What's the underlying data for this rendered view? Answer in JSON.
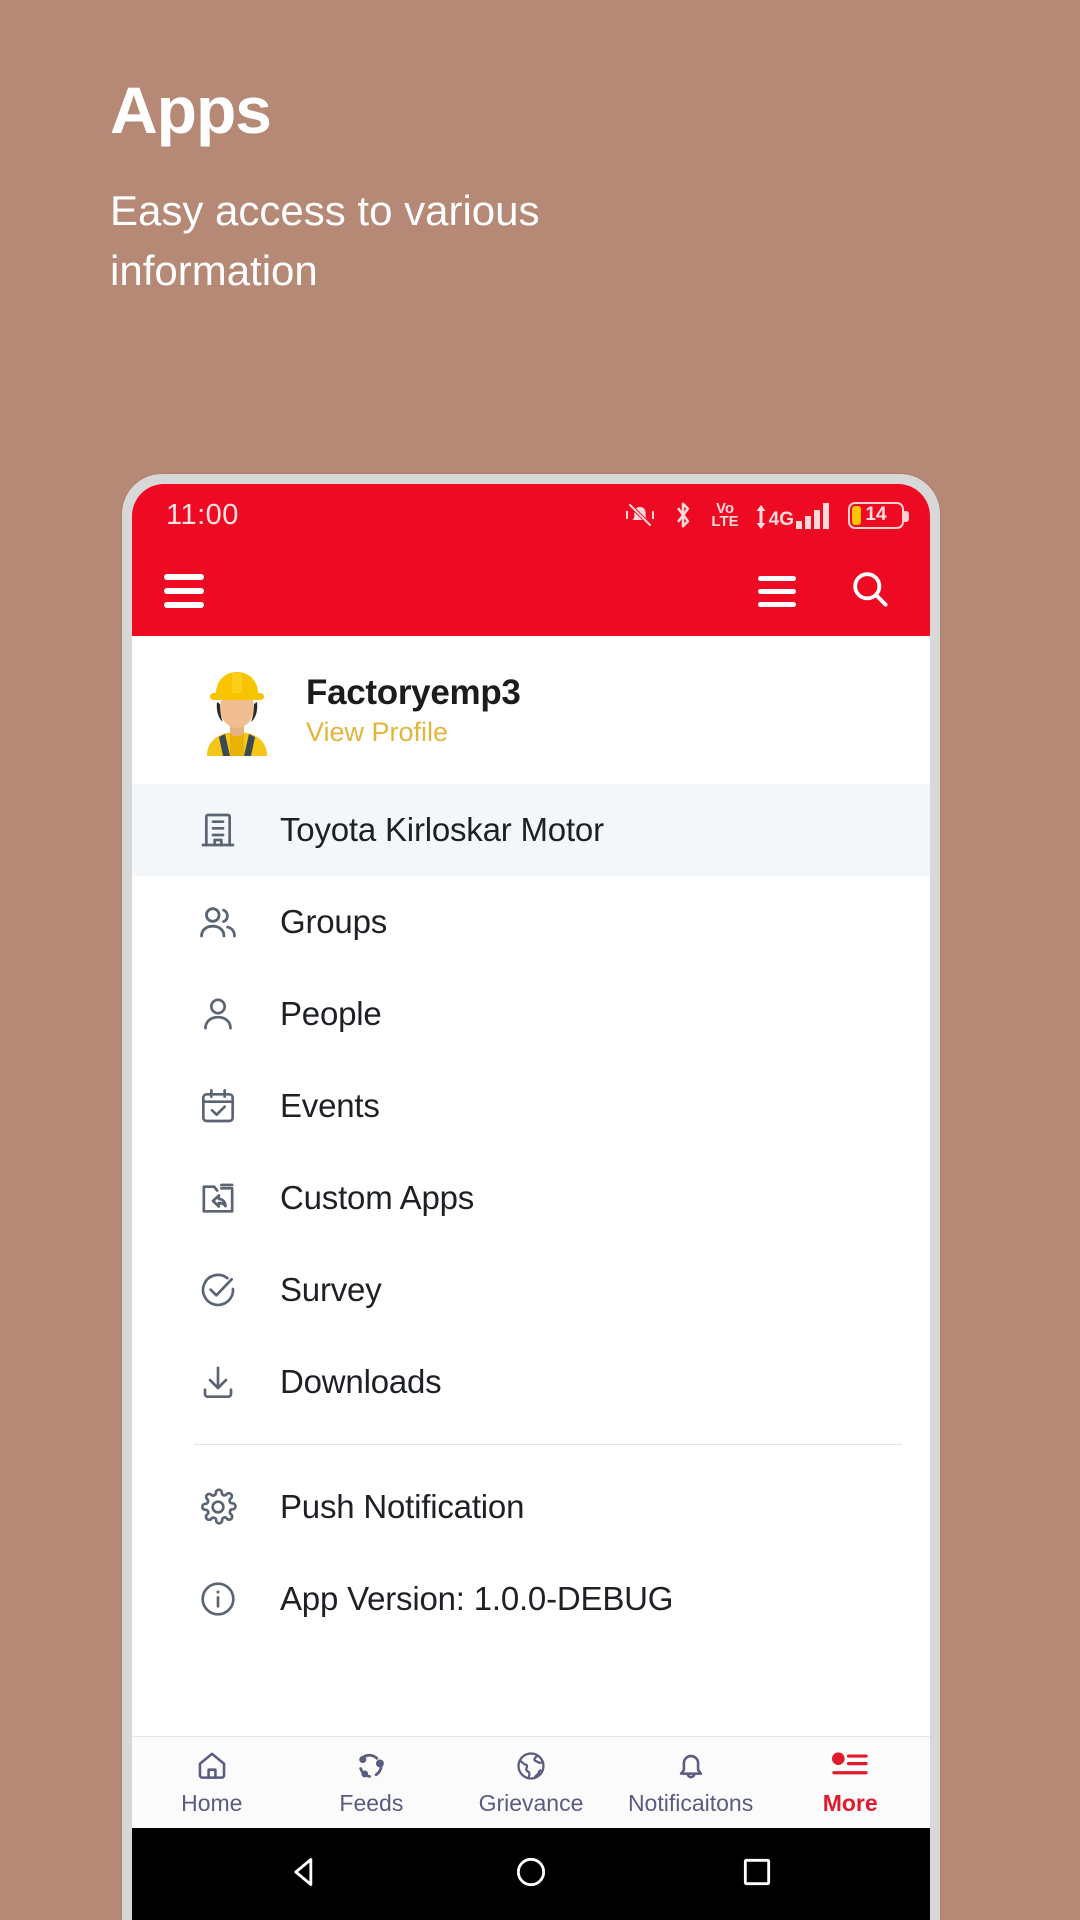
{
  "promo": {
    "title": "Apps",
    "subtitle": "Easy access to various information"
  },
  "colors": {
    "background": "#b68876",
    "brand_red": "#ee0a22",
    "accent_gold": "#e2b63c",
    "nav_inactive": "#5a5b80",
    "nav_active": "#e11b2e",
    "bezel": "#d8d8d8"
  },
  "status_bar": {
    "time": "11:00",
    "battery_percent": "14",
    "network": "4G",
    "volte_top": "Vo",
    "volte_bottom": "LTE",
    "icons": [
      "mute-vibrate-icon",
      "bluetooth-icon",
      "volte-icon",
      "signal-4g-icon",
      "battery-icon"
    ]
  },
  "app_bar": {
    "menu_icon": "hamburger-menu-icon",
    "right_menu_icon": "hamburger-menu-icon",
    "search_icon": "search-icon"
  },
  "profile": {
    "name": "Factoryemp3",
    "link": "View Profile",
    "avatar": "construction-worker-avatar"
  },
  "menu": {
    "items": [
      {
        "label": "Toyota Kirloskar Motor",
        "icon": "building-icon",
        "active": true
      },
      {
        "label": "Groups",
        "icon": "groups-icon",
        "active": false
      },
      {
        "label": "People",
        "icon": "person-icon",
        "active": false
      },
      {
        "label": "Events",
        "icon": "calendar-check-icon",
        "active": false
      },
      {
        "label": "Custom Apps",
        "icon": "custom-apps-icon",
        "active": false
      },
      {
        "label": "Survey",
        "icon": "check-circle-icon",
        "active": false
      },
      {
        "label": "Downloads",
        "icon": "download-icon",
        "active": false
      }
    ],
    "footer_items": [
      {
        "label": "Push Notification",
        "icon": "gear-icon"
      },
      {
        "label": "App Version: 1.0.0-DEBUG",
        "icon": "info-icon"
      }
    ]
  },
  "bottom_nav": {
    "items": [
      {
        "label": "Home",
        "icon": "home-icon",
        "active": false
      },
      {
        "label": "Feeds",
        "icon": "feeds-icon",
        "active": false
      },
      {
        "label": "Grievance",
        "icon": "globe-icon",
        "active": false
      },
      {
        "label": "Notificaitons",
        "icon": "bell-icon",
        "active": false
      },
      {
        "label": "More",
        "icon": "more-list-icon",
        "active": true
      }
    ]
  },
  "android_nav": {
    "back": "back-triangle-icon",
    "home": "home-circle-icon",
    "recents": "recents-square-icon"
  }
}
